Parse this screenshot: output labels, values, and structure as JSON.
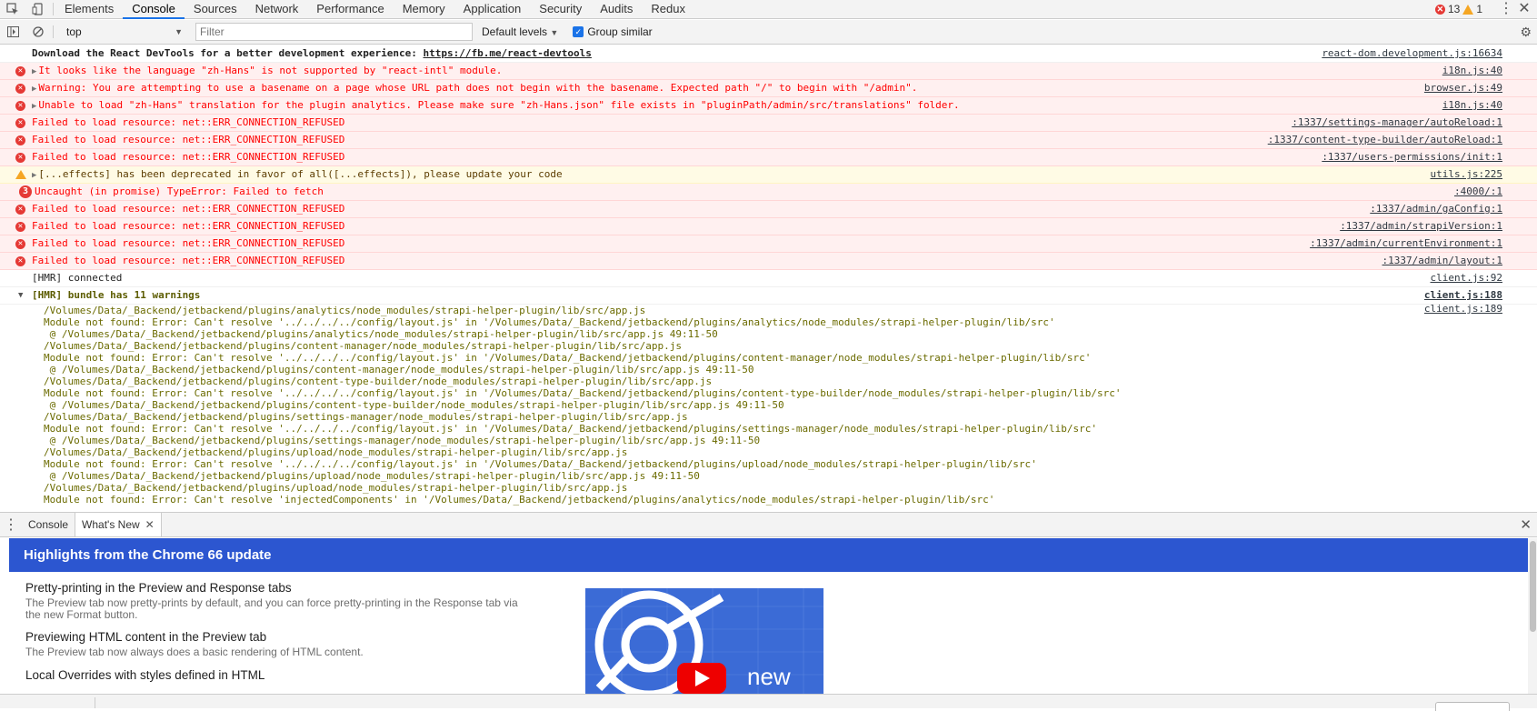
{
  "tabs": [
    "Elements",
    "Console",
    "Sources",
    "Network",
    "Performance",
    "Memory",
    "Application",
    "Security",
    "Audits",
    "Redux"
  ],
  "active_tab": "Console",
  "counts": {
    "errors": "13",
    "warnings": "1"
  },
  "toolbar": {
    "context": "top",
    "filter_placeholder": "Filter",
    "levels": "Default levels",
    "group_similar": "Group similar"
  },
  "messages": [
    {
      "type": "info",
      "text": "Download the React DevTools for a better development experience: ",
      "link": "https://fb.me/react-devtools",
      "source": "react-dom.development.js:16634"
    },
    {
      "type": "error",
      "expand": true,
      "text": "It looks like the language \"zh-Hans\" is not supported by \"react-intl\" module.",
      "source": "i18n.js:40"
    },
    {
      "type": "error",
      "expand": true,
      "text": "Warning: You are attempting to use a basename on a page whose URL path does not begin with the basename. Expected path \"/\" to begin with \"/admin\".",
      "source": "browser.js:49"
    },
    {
      "type": "error",
      "expand": true,
      "text": "Unable to load \"zh-Hans\" translation for the plugin analytics. Please make sure \"zh-Hans.json\" file exists in \"pluginPath/admin/src/translations\" folder.",
      "source": "i18n.js:40"
    },
    {
      "type": "error",
      "text": "Failed to load resource: net::ERR_CONNECTION_REFUSED",
      "source": ":1337/settings-manager/autoReload:1"
    },
    {
      "type": "error",
      "text": "Failed to load resource: net::ERR_CONNECTION_REFUSED",
      "source": ":1337/content-type-builder/autoReload:1"
    },
    {
      "type": "error",
      "text": "Failed to load resource: net::ERR_CONNECTION_REFUSED",
      "source": ":1337/users-permissions/init:1"
    },
    {
      "type": "warn",
      "expand": true,
      "text": "[...effects] has been deprecated in favor of all([...effects]), please update your code",
      "source": "utils.js:225"
    },
    {
      "type": "error-badge",
      "badge": "3",
      "text": "Uncaught (in promise) TypeError: Failed to fetch",
      "source": ":4000/:1"
    },
    {
      "type": "error",
      "text": "Failed to load resource: net::ERR_CONNECTION_REFUSED",
      "source": ":1337/admin/gaConfig:1"
    },
    {
      "type": "error",
      "text": "Failed to load resource: net::ERR_CONNECTION_REFUSED",
      "source": ":1337/admin/strapiVersion:1"
    },
    {
      "type": "error",
      "text": "Failed to load resource: net::ERR_CONNECTION_REFUSED",
      "source": ":1337/admin/currentEnvironment:1"
    },
    {
      "type": "error",
      "text": "Failed to load resource: net::ERR_CONNECTION_REFUSED",
      "source": ":1337/admin/layout:1"
    },
    {
      "type": "info",
      "text": "[HMR] connected",
      "source": "client.js:92"
    },
    {
      "type": "group-head",
      "text": "[HMR] bundle has 11 warnings",
      "source": "client.js:188"
    }
  ],
  "group_body": {
    "source": "client.js:189",
    "lines": [
      "/Volumes/Data/_Backend/jetbackend/plugins/analytics/node_modules/strapi-helper-plugin/lib/src/app.js",
      "Module not found: Error: Can't resolve '../../../../config/layout.js' in '/Volumes/Data/_Backend/jetbackend/plugins/analytics/node_modules/strapi-helper-plugin/lib/src'",
      " @ /Volumes/Data/_Backend/jetbackend/plugins/analytics/node_modules/strapi-helper-plugin/lib/src/app.js 49:11-50",
      "/Volumes/Data/_Backend/jetbackend/plugins/content-manager/node_modules/strapi-helper-plugin/lib/src/app.js",
      "Module not found: Error: Can't resolve '../../../../config/layout.js' in '/Volumes/Data/_Backend/jetbackend/plugins/content-manager/node_modules/strapi-helper-plugin/lib/src'",
      " @ /Volumes/Data/_Backend/jetbackend/plugins/content-manager/node_modules/strapi-helper-plugin/lib/src/app.js 49:11-50",
      "/Volumes/Data/_Backend/jetbackend/plugins/content-type-builder/node_modules/strapi-helper-plugin/lib/src/app.js",
      "Module not found: Error: Can't resolve '../../../../config/layout.js' in '/Volumes/Data/_Backend/jetbackend/plugins/content-type-builder/node_modules/strapi-helper-plugin/lib/src'",
      " @ /Volumes/Data/_Backend/jetbackend/plugins/content-type-builder/node_modules/strapi-helper-plugin/lib/src/app.js 49:11-50",
      "/Volumes/Data/_Backend/jetbackend/plugins/settings-manager/node_modules/strapi-helper-plugin/lib/src/app.js",
      "Module not found: Error: Can't resolve '../../../../config/layout.js' in '/Volumes/Data/_Backend/jetbackend/plugins/settings-manager/node_modules/strapi-helper-plugin/lib/src'",
      " @ /Volumes/Data/_Backend/jetbackend/plugins/settings-manager/node_modules/strapi-helper-plugin/lib/src/app.js 49:11-50",
      "/Volumes/Data/_Backend/jetbackend/plugins/upload/node_modules/strapi-helper-plugin/lib/src/app.js",
      "Module not found: Error: Can't resolve '../../../../config/layout.js' in '/Volumes/Data/_Backend/jetbackend/plugins/upload/node_modules/strapi-helper-plugin/lib/src'",
      " @ /Volumes/Data/_Backend/jetbackend/plugins/upload/node_modules/strapi-helper-plugin/lib/src/app.js 49:11-50",
      "/Volumes/Data/_Backend/jetbackend/plugins/upload/node_modules/strapi-helper-plugin/lib/src/app.js",
      "Module not found: Error: Can't resolve 'injectedComponents' in '/Volumes/Data/_Backend/jetbackend/plugins/analytics/node_modules/strapi-helper-plugin/lib/src'"
    ]
  },
  "drawer": {
    "tabs": [
      "Console",
      "What's New"
    ],
    "active": "What's New",
    "banner": "Highlights from the Chrome 66 update",
    "features": [
      {
        "title": "Pretty-printing in the Preview and Response tabs",
        "desc": "The Preview tab now pretty-prints by default, and you can force pretty-printing in the Response tab via the new Format button."
      },
      {
        "title": "Previewing HTML content in the Preview tab",
        "desc": "The Preview tab now always does a basic rendering of HTML content."
      },
      {
        "title": "Local Overrides with styles defined in HTML",
        "desc": ""
      }
    ],
    "video_label": "new"
  },
  "colors": {
    "accent": "#1a73e8",
    "banner": "#2c56d0",
    "error_bg": "#fff0f0",
    "warn_bg": "#fffbe5",
    "error_text": "#ff0000"
  }
}
